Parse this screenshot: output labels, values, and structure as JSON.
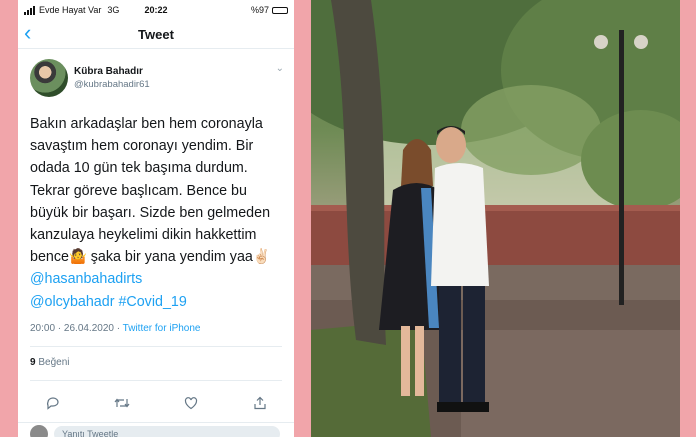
{
  "status": {
    "carrier": "Evde Hayat Var",
    "network": "3G",
    "time": "20:22",
    "battery": "%97",
    "battery_level": 0.97
  },
  "nav": {
    "title": "Tweet"
  },
  "author": {
    "display_name": "Kübra Bahadır",
    "handle": "@kubrabahadir61"
  },
  "tweet": {
    "text": "Bakın arkadaşlar ben hem coronayla savaştım hem coronayı yendim. Bir odada 10 gün tek başıma durdum. Tekrar göreve başlıcam. Bence bu büyük bir başarı.  Sizde ben gelmeden kanzulaya heykelimi dikin hakkettim bence🤷 şaka bir yana yendim yaa✌🏻 ",
    "mentions": [
      "@hasanbahadirts",
      "@olcybahadr"
    ],
    "hashtag": "#Covid_19"
  },
  "meta": {
    "timestamp": "20:00 · 26.04.2020 · ",
    "source": "Twitter for iPhone"
  },
  "likes": {
    "count": "9",
    "label": "Beğeni"
  },
  "actions": {
    "reply": "reply-icon",
    "retweet": "retweet-icon",
    "like": "heart-icon",
    "share": "share-icon"
  },
  "composer": {
    "placeholder": "Yanıtı Tweetle"
  },
  "colors": {
    "link": "#1da1f2",
    "background_frame": "#f1a5aa"
  }
}
